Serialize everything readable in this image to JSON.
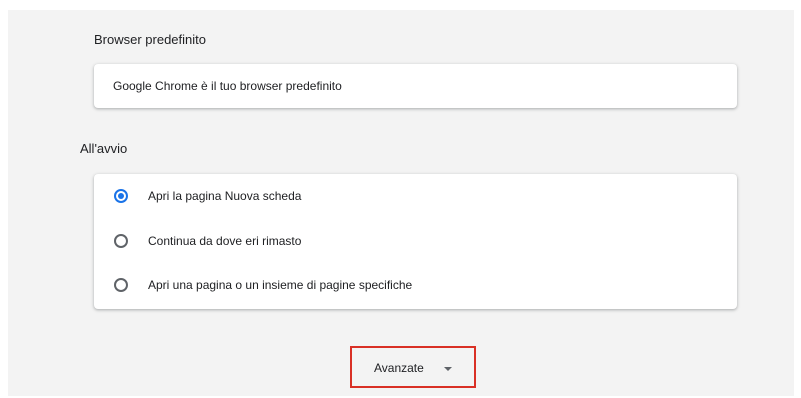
{
  "default_browser": {
    "title": "Browser predefinito",
    "status": "Google Chrome è il tuo browser predefinito"
  },
  "startup": {
    "title": "All'avvio",
    "options": [
      {
        "label": "Apri la pagina Nuova scheda",
        "checked": true
      },
      {
        "label": "Continua da dove eri rimasto",
        "checked": false
      },
      {
        "label": "Apri una pagina o un insieme di pagine specifiche",
        "checked": false
      }
    ]
  },
  "advanced": {
    "label": "Avanzate",
    "icon": "caret-down-icon",
    "highlight_color": "#d93025"
  },
  "colors": {
    "accent": "#1a73e8",
    "background": "#f3f3f3"
  }
}
